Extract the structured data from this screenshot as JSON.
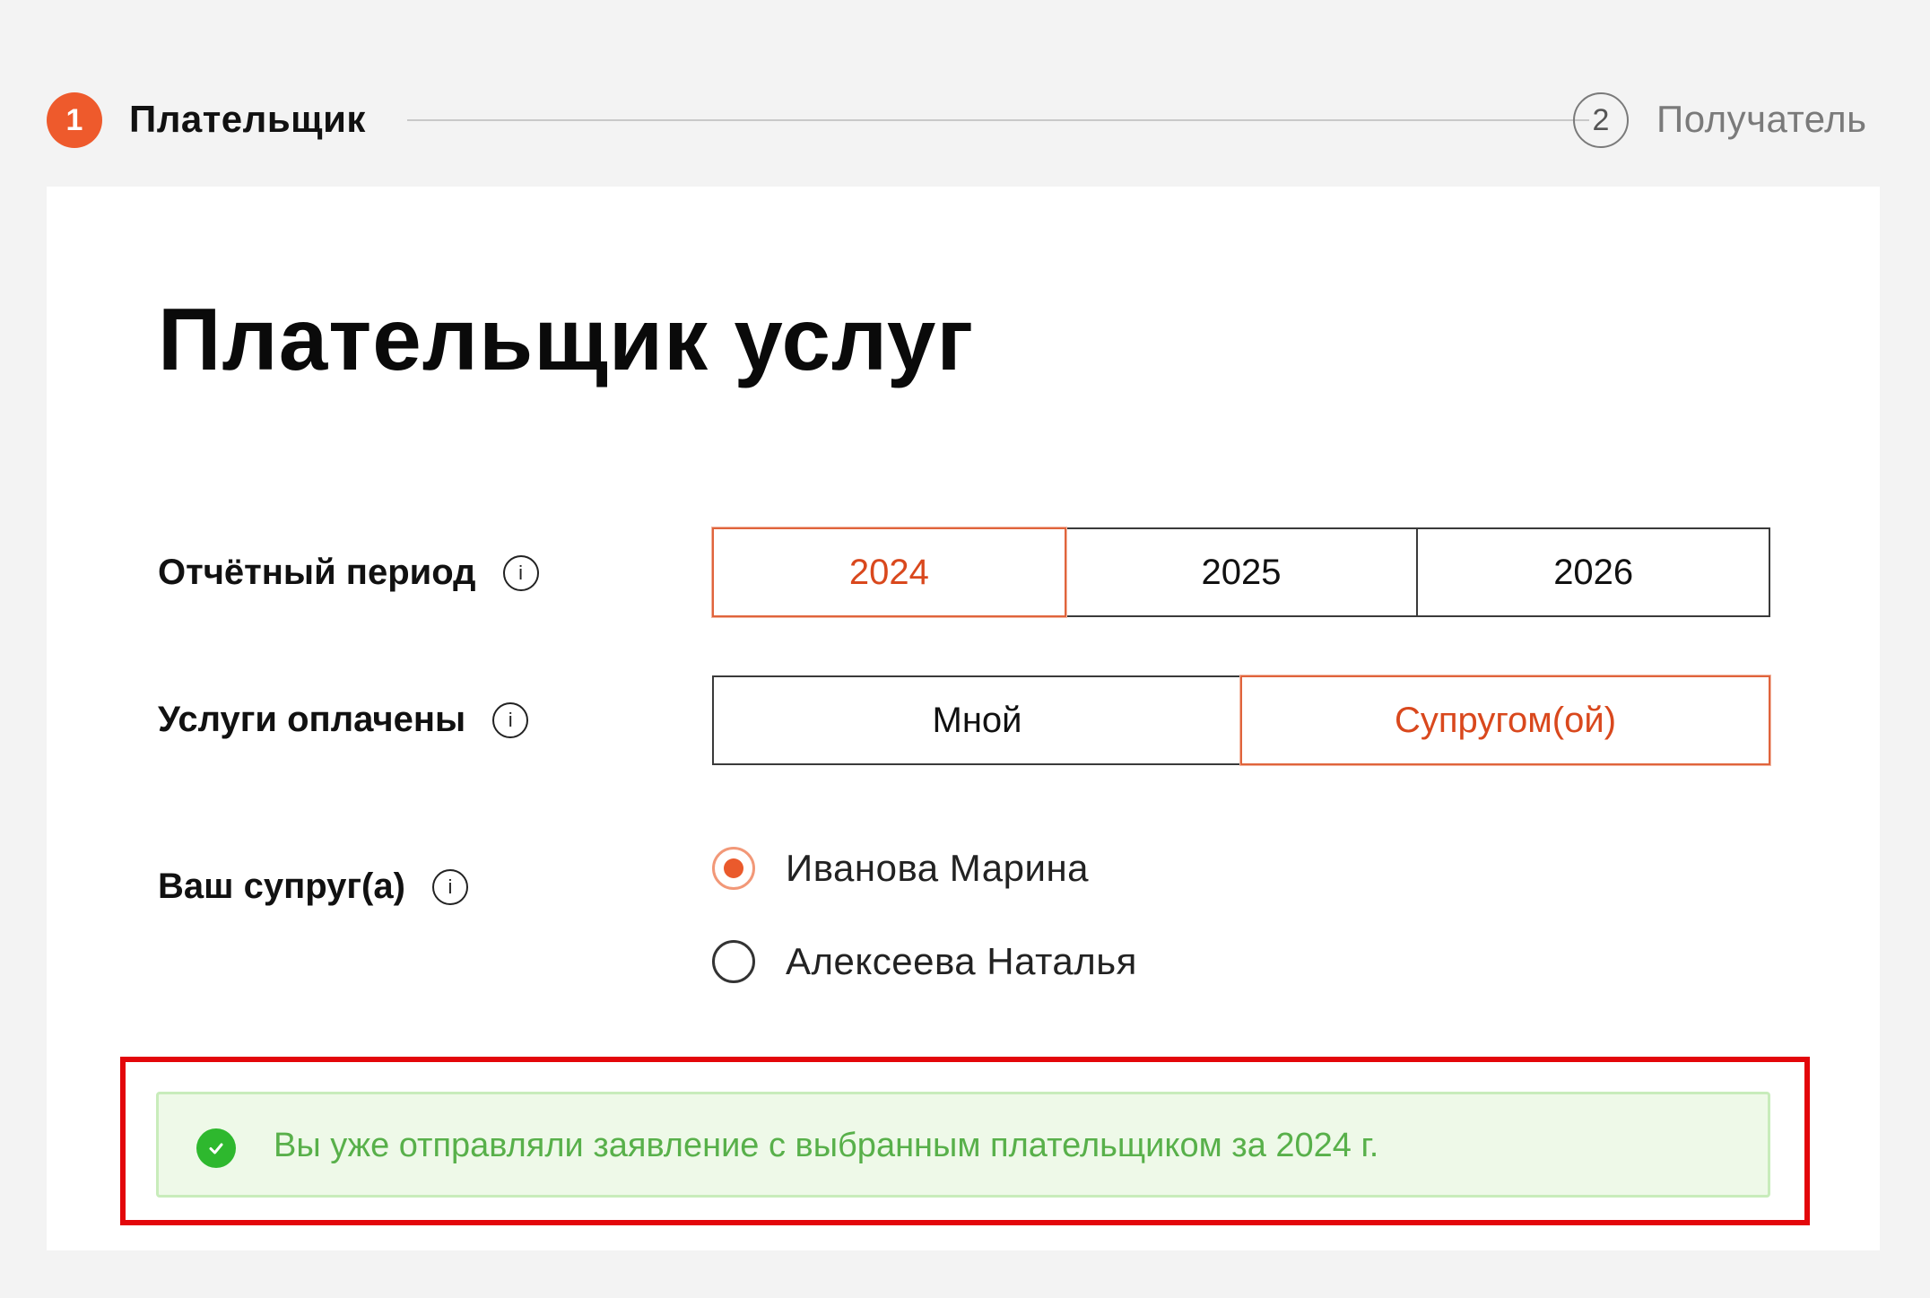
{
  "stepper": {
    "step1": {
      "number": "1",
      "label": "Плательщик"
    },
    "step2": {
      "number": "2",
      "label": "Получатель"
    }
  },
  "card": {
    "title": "Плательщик услуг"
  },
  "period": {
    "label": "Отчётный период",
    "options": [
      "2024",
      "2025",
      "2026"
    ],
    "selected": "2024"
  },
  "paid_by": {
    "label": "Услуги оплачены",
    "options": [
      "Мной",
      "Супругом(ой)"
    ],
    "selected": "Супругом(ой)"
  },
  "spouse": {
    "label": "Ваш супруг(а)",
    "options": [
      "Иванова Марина",
      "Алексеева Наталья"
    ],
    "selected": "Иванова Марина"
  },
  "notice": {
    "text": "Вы уже отправляли заявление с выбранным плательщиком за 2024 г."
  },
  "colors": {
    "accent": "#ee5a2c",
    "success": "#2eb82e",
    "highlight_border": "#e3070a"
  },
  "icons": {
    "info": "info-icon",
    "check": "check-circle-icon"
  }
}
